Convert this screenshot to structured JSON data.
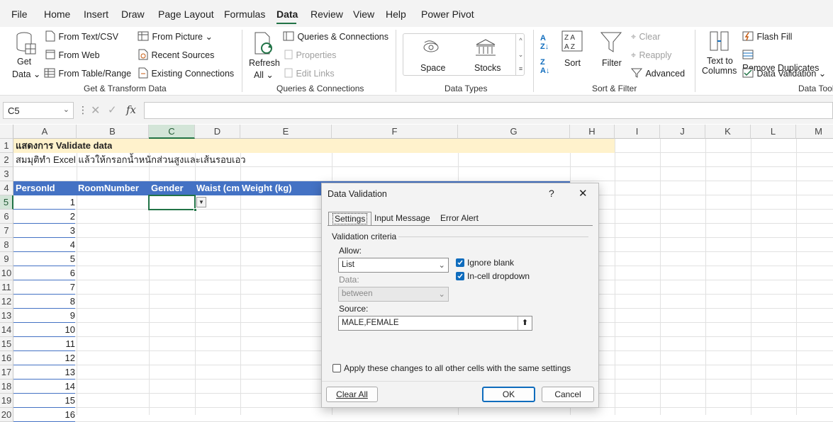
{
  "menu": {
    "items": [
      "File",
      "Home",
      "Insert",
      "Draw",
      "Page Layout",
      "Formulas",
      "Data",
      "Review",
      "View",
      "Help",
      "Power Pivot"
    ]
  },
  "ribbon": {
    "get_data": [
      "Get",
      "Data"
    ],
    "from_text": "From Text/CSV",
    "from_web": "From Web",
    "from_table": "From Table/Range",
    "from_picture": "From Picture",
    "recent_sources": "Recent Sources",
    "existing_connections": "Existing Connections",
    "group_get": "Get & Transform Data",
    "refresh": [
      "Refresh",
      "All"
    ],
    "queries_connections": "Queries & Connections",
    "properties": "Properties",
    "edit_links": "Edit Links",
    "group_queries": "Queries & Connections",
    "space": "Space",
    "stocks": "Stocks",
    "group_types": "Data Types",
    "sort": "Sort",
    "filter": "Filter",
    "clear": "Clear",
    "reapply": "Reapply",
    "advanced": "Advanced",
    "group_sort": "Sort & Filter",
    "text_to_columns": [
      "Text to",
      "Columns"
    ],
    "flash_fill": "Flash Fill",
    "remove_duplicates": "Remove Duplicates",
    "data_validation": "Data Validation",
    "group_tools": "Data Tools"
  },
  "formula_bar": {
    "name_box": "C5",
    "fx": "fx"
  },
  "columns": [
    "A",
    "B",
    "C",
    "D",
    "E",
    "F",
    "G",
    "H",
    "I",
    "J",
    "K",
    "L",
    "M"
  ],
  "rows": [
    "1",
    "2",
    "3",
    "4",
    "5",
    "6",
    "7",
    "8",
    "9",
    "10",
    "11",
    "12",
    "13",
    "14",
    "15",
    "16",
    "17",
    "18",
    "19",
    "20"
  ],
  "sheet": {
    "title": "แสดงการ Validate data",
    "subtitle": "สมมุติทำ Excel แล้วให้กรอกน้ำหนักส่วนสูงและเส้นรอบเอว",
    "headers": [
      "PersonId",
      "RoomNumber",
      "Gender",
      "Waist (cm",
      "Weight (kg)"
    ],
    "person_ids": [
      "1",
      "2",
      "3",
      "4",
      "5",
      "6",
      "7",
      "8",
      "9",
      "10",
      "11",
      "12",
      "13",
      "14",
      "15",
      "16"
    ]
  },
  "dialog": {
    "title": "Data Validation",
    "help": "?",
    "close": "✕",
    "tabs": [
      "Settings",
      "Input Message",
      "Error Alert"
    ],
    "section": "Validation criteria",
    "allow_label": "Allow:",
    "allow_value": "List",
    "data_label": "Data:",
    "data_value": "between",
    "ignore_blank": "Ignore blank",
    "ignore_blank_checked": true,
    "in_cell_dropdown": "In-cell dropdown",
    "in_cell_dropdown_checked": true,
    "source_label": "Source:",
    "source_value": "MALE,FEMALE",
    "apply_all": "Apply these changes to all other cells with the same settings",
    "apply_all_checked": false,
    "clear_all": "Clear All",
    "ok": "OK",
    "cancel": "Cancel"
  },
  "colors": {
    "accent": "#217346",
    "header_fill": "#4472c4",
    "title_fill": "#fff2cc",
    "dialog_primary": "#0f6cbd"
  }
}
